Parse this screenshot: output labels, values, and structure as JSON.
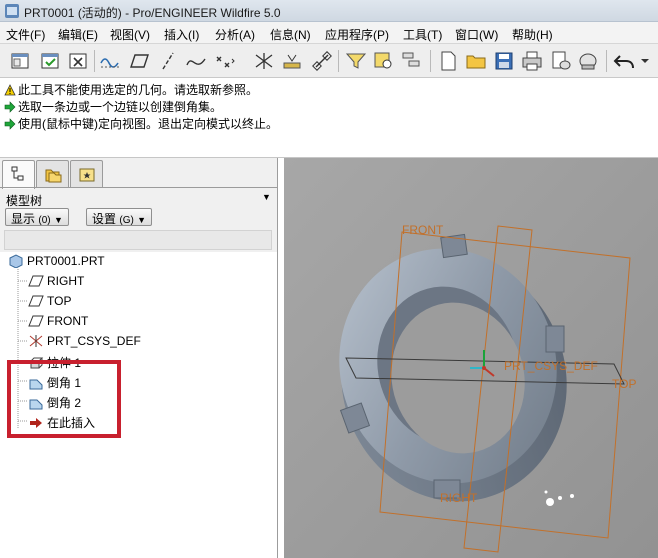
{
  "window": {
    "title": "PRT0001 (活动的) - Pro/ENGINEER Wildfire 5.0"
  },
  "menu": {
    "items": [
      {
        "label": "文件(F)"
      },
      {
        "label": "编辑(E)"
      },
      {
        "label": "视图(V)"
      },
      {
        "label": "插入(I)"
      },
      {
        "label": "分析(A)"
      },
      {
        "label": "信息(N)"
      },
      {
        "label": "应用程序(P)"
      },
      {
        "label": "工具(T)"
      },
      {
        "label": "窗口(W)"
      },
      {
        "label": "帮助(H)"
      }
    ]
  },
  "messages": [
    {
      "icon": "warning-icon",
      "text": "此工具不能使用选定的几何。请选取新参照。"
    },
    {
      "icon": "arrow-right-icon",
      "text": "选取一条边或一个边链以创建倒角集。"
    },
    {
      "icon": "arrow-right-icon",
      "text": "使用(鼠标中键)定向视图。退出定向模式以终止。"
    }
  ],
  "model_tree": {
    "header": "模型树",
    "show_button": "显示",
    "show_shortcut": "(0)",
    "settings_button": "设置",
    "settings_shortcut": "(G)",
    "root": "PRT0001.PRT",
    "items": [
      {
        "label": "RIGHT",
        "icon": "datum-plane-icon"
      },
      {
        "label": "TOP",
        "icon": "datum-plane-icon"
      },
      {
        "label": "FRONT",
        "icon": "datum-plane-icon"
      },
      {
        "label": "PRT_CSYS_DEF",
        "icon": "csys-icon"
      },
      {
        "label": "拉伸 1",
        "icon": "extrude-icon"
      },
      {
        "label": "倒角 1",
        "icon": "chamfer-icon"
      },
      {
        "label": "倒角 2",
        "icon": "chamfer-icon"
      },
      {
        "label": "在此插入",
        "icon": "insert-here-icon"
      }
    ]
  },
  "viewport": {
    "labels": {
      "front": "FRONT",
      "top": "TOP",
      "right": "RIGHT",
      "csys": "PRT_CSYS_DEF"
    }
  },
  "colors": {
    "highlight": "#c8202e",
    "datum": "#c2702a",
    "viewport_bg": "#9e9e9e"
  }
}
